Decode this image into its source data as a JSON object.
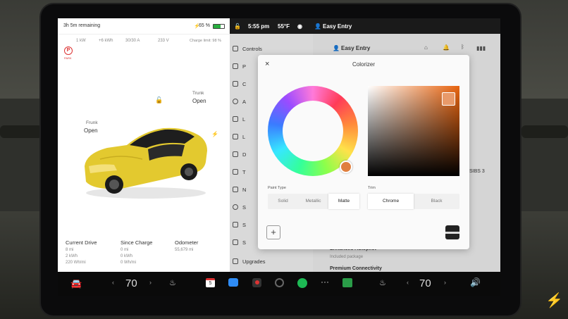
{
  "left_panel": {
    "range": "3h 5m remaining",
    "battery_pct": "65 %",
    "battery_level": 0.65,
    "charge_stats": [
      "1 kW",
      "+6 kWh",
      "30/30 A",
      "233 V"
    ],
    "charge_limit": "Charge limit: 98 %",
    "park_label": "PARK",
    "frunk_label": "Frunk",
    "frunk_state": "Open",
    "trunk_label": "Trunk",
    "trunk_state": "Open",
    "stats": [
      {
        "title": "Current Drive",
        "lines": [
          "8 mi",
          "2 kWh",
          "220 Wh/mi"
        ]
      },
      {
        "title": "Since Charge",
        "lines": [
          "0 mi",
          "0 kWh",
          "0 Wh/mi"
        ]
      },
      {
        "title": "Odometer",
        "lines": [
          "55,679 mi"
        ]
      }
    ]
  },
  "status_bar": {
    "time": "5:55 pm",
    "temp": "55°F",
    "profile": "Easy Entry"
  },
  "settings": {
    "profile_title": "Easy Entry",
    "menu": [
      "Controls",
      "P",
      "C",
      "A",
      "L",
      "L",
      "D",
      "T",
      "N",
      "S",
      "S",
      "S",
      "Upgrades"
    ],
    "fragment": "SIBS 3",
    "enhanced_autopilot": "Enhanced Autopilot",
    "included_package": "Included package",
    "premium_connectivity": "Premium Connectivity"
  },
  "colorizer": {
    "title": "Colorizer",
    "paint_type_label": "Paint Type",
    "paint_types": [
      "Solid",
      "Metallic",
      "Matte"
    ],
    "paint_selected": "Matte",
    "trim_label": "Trim",
    "trims": [
      "Chrome",
      "Black"
    ],
    "trim_selected": "Chrome",
    "add_symbol": "+",
    "close_symbol": "×"
  },
  "dock": {
    "left_temp": "70",
    "right_temp": "70",
    "calendar_day": "5"
  },
  "colors": {
    "car_yellow": "#e8cf3a",
    "selected_swatch": "#e07f3e"
  }
}
